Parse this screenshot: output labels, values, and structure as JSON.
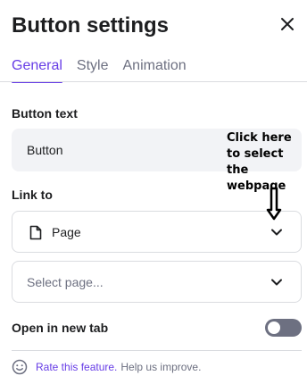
{
  "header": {
    "title": "Button settings",
    "close_icon": "close-icon"
  },
  "tabs": [
    {
      "label": "General",
      "active": true
    },
    {
      "label": "Style",
      "active": false
    },
    {
      "label": "Animation",
      "active": false
    }
  ],
  "button_text": {
    "label": "Button text",
    "value": "Button"
  },
  "link_to": {
    "label": "Link to",
    "type_select": {
      "value": "Page",
      "icon": "document-icon"
    },
    "page_select": {
      "placeholder": "Select page..."
    }
  },
  "open_new_tab": {
    "label": "Open in new tab",
    "enabled": false
  },
  "feedback": {
    "link_text": "Rate this feature.",
    "text": "Help us improve.",
    "icon": "smile-icon"
  },
  "annotation": {
    "text": "Click here to select the webpage"
  },
  "colors": {
    "accent": "#673de6",
    "muted": "#6d7081",
    "input_bg": "#f2f3f6",
    "border": "#dadce0"
  }
}
